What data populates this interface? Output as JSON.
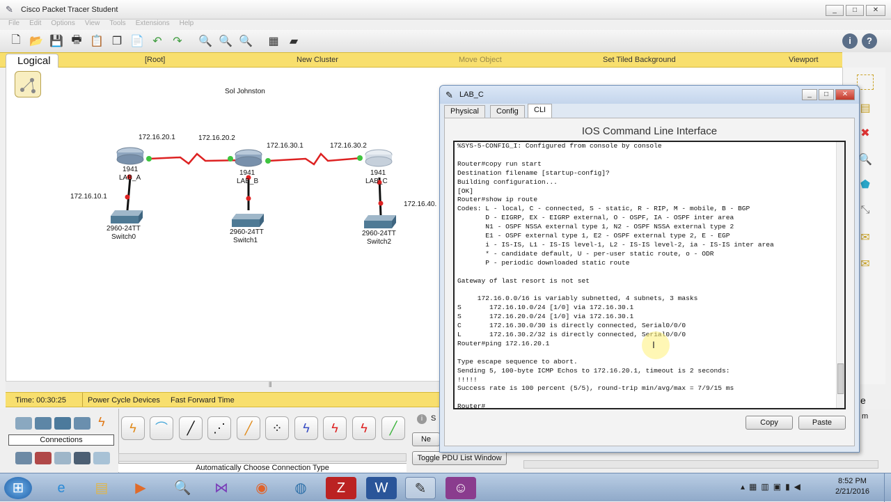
{
  "app": {
    "title": "Cisco Packet Tracer Student",
    "window_buttons": [
      "_",
      "□",
      "✕"
    ]
  },
  "menu": [
    "File",
    "Edit",
    "Options",
    "View",
    "Tools",
    "Extensions",
    "Help"
  ],
  "toolbar_icons": [
    "new-icon",
    "open-icon",
    "save-icon",
    "print-icon",
    "activity-wizard-icon",
    "copy-icon",
    "paste-icon",
    "undo-icon",
    "redo-icon",
    "zoom-in-icon",
    "zoom-reset-icon",
    "zoom-out-icon",
    "palette-icon",
    "custom-device-icon"
  ],
  "workspace_bar": {
    "tab": "Logical",
    "root": "[Root]",
    "new_cluster": "New Cluster",
    "move_object": "Move Object",
    "set_tiled_background": "Set Tiled Background",
    "viewport": "Viewport"
  },
  "topology": {
    "note": "Sol Johnston",
    "routers": [
      {
        "model": "1941",
        "name": "LAB_A"
      },
      {
        "model": "1941",
        "name": "LAB_B"
      },
      {
        "model": "1941",
        "name": "LAB_C"
      }
    ],
    "switches": [
      {
        "model": "2960-24TT",
        "name": "Switch0"
      },
      {
        "model": "2960-24TT",
        "name": "Switch1"
      },
      {
        "model": "2960-24TT",
        "name": "Switch2"
      }
    ],
    "ip_labels": [
      "172.16.20.1",
      "172.16.20.2",
      "172.16.30.1",
      "172.16.30.2",
      "172.16.10.1",
      "172.16.40."
    ]
  },
  "timebar": {
    "time": "Time: 00:30:25",
    "power_cycle": "Power Cycle Devices",
    "fast_forward": "Fast Forward Time"
  },
  "bottom": {
    "category_label": "Connections",
    "connection_type": "Automatically Choose Connection Type",
    "toggle_pdu": "Toggle PDU List Window",
    "new_partial": "Ne",
    "scenario_partial": "S"
  },
  "labc_window": {
    "title": "LAB_C",
    "tabs": [
      "Physical",
      "Config",
      "CLI"
    ],
    "heading": "IOS Command Line Interface",
    "cli_lines": [
      "%SYS-5-CONFIG_I: Configured from console by console",
      "",
      "Router#copy run start",
      "Destination filename [startup-config]?",
      "Building configuration...",
      "[OK]",
      "Router#show ip route",
      "Codes: L - local, C - connected, S - static, R - RIP, M - mobile, B - BGP",
      "       D - EIGRP, EX - EIGRP external, O - OSPF, IA - OSPF inter area",
      "       N1 - OSPF NSSA external type 1, N2 - OSPF NSSA external type 2",
      "       E1 - OSPF external type 1, E2 - OSPF external type 2, E - EGP",
      "       i - IS-IS, L1 - IS-IS level-1, L2 - IS-IS level-2, ia - IS-IS inter area",
      "       * - candidate default, U - per-user static route, o - ODR",
      "       P - periodic downloaded static route",
      "",
      "Gateway of last resort is not set",
      "",
      "     172.16.0.0/16 is variably subnetted, 4 subnets, 3 masks",
      "S       172.16.10.0/24 [1/0] via 172.16.30.1",
      "S       172.16.20.0/24 [1/0] via 172.16.30.1",
      "C       172.16.30.0/30 is directly connected, Serial0/0/0",
      "L       172.16.30.2/32 is directly connected, Serial0/0/0",
      "Router#ping 172.16.20.1",
      "",
      "Type escape sequence to abort.",
      "Sending 5, 100-byte ICMP Echos to 172.16.20.1, timeout is 2 seconds:",
      "!!!!!",
      "Success rate is 100 percent (5/5), round-trip min/avg/max = 7/9/15 ms",
      "",
      "Router#"
    ],
    "copy_button": "Copy",
    "paste_button": "Paste"
  },
  "right_palette_partial": "e",
  "right_palette_partial2": "m",
  "taskbar": {
    "clock_time": "8:52 PM",
    "clock_date": "2/21/2016"
  }
}
